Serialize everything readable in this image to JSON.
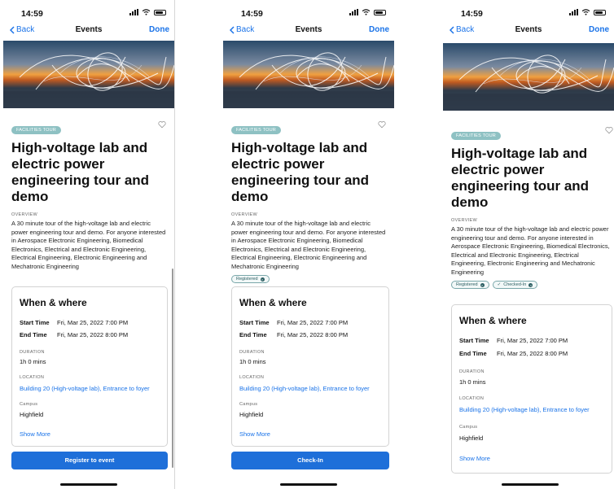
{
  "screens": [
    {
      "status_time": "14:59",
      "nav": {
        "back": "Back",
        "title": "Events",
        "done": "Done"
      },
      "tag": "FACILITIES TOUR",
      "title": "High-voltage lab and electric power engineering tour and demo",
      "overview_label": "OVERVIEW",
      "description": "A 30 minute tour of the high-voltage lab and electric power engineering tour and demo. For anyone interested in Aerospace Electronic Engineering, Biomedical Electronics, Electrical and Electronic Engineering, Electrical Engineering, Electronic Engineering and Mechatronic Engineering",
      "chips": [],
      "card": {
        "heading": "When & where",
        "start_label": "Start Time",
        "start_value": "Fri, Mar 25, 2022 7:00 PM",
        "end_label": "End Time",
        "end_value": "Fri, Mar 25, 2022 8:00 PM",
        "duration_label": "DURATION",
        "duration_value": "1h 0 mins",
        "location_label": "LOCATION",
        "location_value": "Building 20 (High-voltage lab), Entrance to foyer",
        "campus_label": "Campus",
        "campus_value": "Highfield",
        "show_more": "Show More"
      },
      "cta": "Register to event"
    },
    {
      "status_time": "14:59",
      "nav": {
        "back": "Back",
        "title": "Events",
        "done": "Done"
      },
      "tag": "FACILITIES TOUR",
      "title": "High-voltage lab and electric power engineering tour and demo",
      "overview_label": "OVERVIEW",
      "description": "A 30 minute tour of the high-voltage lab and electric power engineering tour and demo. For anyone interested in Aerospace Electronic Engineering, Biomedical Electronics, Electrical and Electronic Engineering, Electrical Engineering, Electronic Engineering and Mechatronic Engineering",
      "chips": [
        "Registered"
      ],
      "card": {
        "heading": "When & where",
        "start_label": "Start Time",
        "start_value": "Fri, Mar 25, 2022 7:00 PM",
        "end_label": "End Time",
        "end_value": "Fri, Mar 25, 2022 8:00 PM",
        "duration_label": "DURATION",
        "duration_value": "1h 0 mins",
        "location_label": "LOCATION",
        "location_value": "Building 20 (High-voltage lab), Entrance to foyer",
        "campus_label": "Campus",
        "campus_value": "Highfield",
        "show_more": "Show More"
      },
      "cta": "Check-In"
    },
    {
      "status_time": "14:59",
      "nav": {
        "back": "Back",
        "title": "Events",
        "done": "Done"
      },
      "tag": "FACILITIES TOUR",
      "title": "High-voltage lab and electric power engineering tour and demo",
      "overview_label": "OVERVIEW",
      "description": "A 30 minute tour of the high-voltage lab and electric power engineering tour and demo. For anyone interested in Aerospace Electronic Engineering, Biomedical Electronics, Electrical and Electronic Engineering, Electrical Engineering, Electronic Engineering and Mechatronic Engineering",
      "chips": [
        "Registered",
        "Checked-In"
      ],
      "card": {
        "heading": "When & where",
        "start_label": "Start Time",
        "start_value": "Fri, Mar 25, 2022 7:00 PM",
        "end_label": "End Time",
        "end_value": "Fri, Mar 25, 2022 8:00 PM",
        "duration_label": "DURATION",
        "duration_value": "1h 0 mins",
        "location_label": "LOCATION",
        "location_value": "Building 20 (High-voltage lab), Entrance to foyer",
        "campus_label": "Campus",
        "campus_value": "Highfield",
        "show_more": "Show More"
      },
      "cta": ""
    }
  ],
  "colors": {
    "accent": "#1a73e8",
    "button": "#1e6fd9",
    "tag": "#8ec1c3"
  }
}
